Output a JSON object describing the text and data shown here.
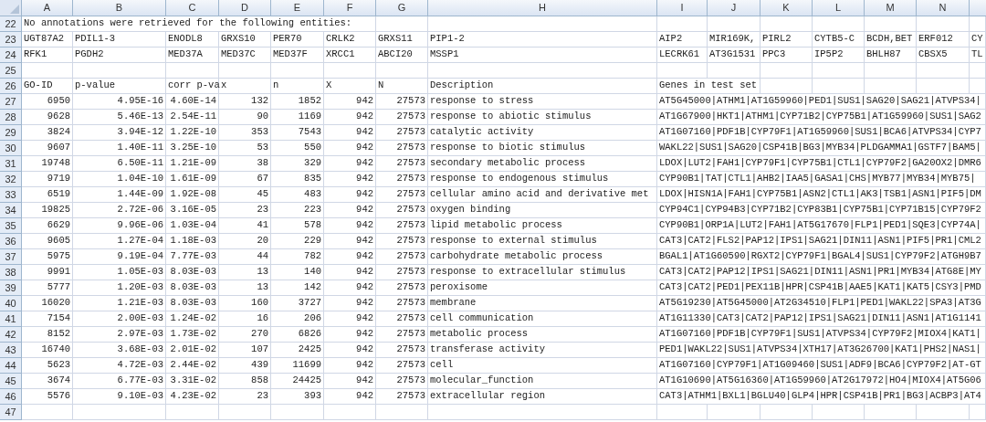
{
  "columns": [
    "A",
    "B",
    "C",
    "D",
    "E",
    "F",
    "G",
    "H",
    "I",
    "J",
    "K",
    "L",
    "M",
    "N"
  ],
  "rows": [
    {
      "number": "22",
      "kind": "note",
      "text": "No annotations were retrieved for the following entities:"
    },
    {
      "number": "23",
      "kind": "entities",
      "cells": [
        "UGT87A2",
        "PDIL1-3",
        "ENODL8",
        "GRXS10",
        "PER70",
        "CRLK2",
        "GRXS11",
        "PIP1-2",
        "AIP2",
        "MIR169K,",
        "PIRL2",
        "CYTB5-C",
        "BCDH,BET",
        "ERF012",
        "CY"
      ]
    },
    {
      "number": "24",
      "kind": "entities",
      "cells": [
        "RFK1",
        "PGDH2",
        "MED37A",
        "MED37C",
        "MED37F",
        "XRCC1",
        "ABCI20",
        "MSSP1",
        "LECRK61",
        "AT3G1531",
        "PPC3",
        "IP5P2",
        "BHLH87",
        "CBSX5",
        "TL"
      ]
    },
    {
      "number": "25",
      "kind": "blank"
    },
    {
      "number": "26",
      "kind": "header",
      "cells": [
        "GO-ID",
        "p-value",
        "corr p-va",
        "x",
        "n",
        "X",
        "N",
        "Description",
        "Genes in test set"
      ]
    },
    {
      "number": "27",
      "kind": "data",
      "cells": [
        "6950",
        "4.95E-16",
        "4.60E-14",
        "132",
        "1852",
        "942",
        "27573",
        "response to stress",
        "AT5G45000|ATHM1|AT1G59960|PED1|SUS1|SAG20|SAG21|ATVPS34|"
      ]
    },
    {
      "number": "28",
      "kind": "data",
      "cells": [
        "9628",
        "5.46E-13",
        "2.54E-11",
        "90",
        "1169",
        "942",
        "27573",
        "response to abiotic stimulus",
        "AT1G67900|HKT1|ATHM1|CYP71B2|CYP75B1|AT1G59960|SUS1|SAG2"
      ]
    },
    {
      "number": "29",
      "kind": "data",
      "cells": [
        "3824",
        "3.94E-12",
        "1.22E-10",
        "353",
        "7543",
        "942",
        "27573",
        "catalytic activity",
        "AT1G07160|PDF1B|CYP79F1|AT1G59960|SUS1|BCA6|ATVPS34|CYP7"
      ]
    },
    {
      "number": "30",
      "kind": "data",
      "cells": [
        "9607",
        "1.40E-11",
        "3.25E-10",
        "53",
        "550",
        "942",
        "27573",
        "response to biotic stimulus",
        "WAKL22|SUS1|SAG20|CSP41B|BG3|MYB34|PLDGAMMA1|GSTF7|BAM5|"
      ]
    },
    {
      "number": "31",
      "kind": "data",
      "cells": [
        "19748",
        "6.50E-11",
        "1.21E-09",
        "38",
        "329",
        "942",
        "27573",
        "secondary metabolic process",
        "LDOX|LUT2|FAH1|CYP79F1|CYP75B1|CTL1|CYP79F2|GA20OX2|DMR6"
      ]
    },
    {
      "number": "32",
      "kind": "data",
      "cells": [
        "9719",
        "1.04E-10",
        "1.61E-09",
        "67",
        "835",
        "942",
        "27573",
        "response to endogenous stimulus",
        "CYP90B1|TAT|CTL1|AHB2|IAA5|GASA1|CHS|MYB77|MYB34|MYB75|"
      ]
    },
    {
      "number": "33",
      "kind": "data",
      "cells": [
        "6519",
        "1.44E-09",
        "1.92E-08",
        "45",
        "483",
        "942",
        "27573",
        "cellular amino acid and derivative met",
        "LDOX|HISN1A|FAH1|CYP75B1|ASN2|CTL1|AK3|TSB1|ASN1|PIF5|DM"
      ]
    },
    {
      "number": "34",
      "kind": "data",
      "cells": [
        "19825",
        "2.72E-06",
        "3.16E-05",
        "23",
        "223",
        "942",
        "27573",
        "oxygen binding",
        "CYP94C1|CYP94B3|CYP71B2|CYP83B1|CYP75B1|CYP71B15|CYP79F2"
      ]
    },
    {
      "number": "35",
      "kind": "data",
      "cells": [
        "6629",
        "9.96E-06",
        "1.03E-04",
        "41",
        "578",
        "942",
        "27573",
        "lipid metabolic process",
        "CYP90B1|ORP1A|LUT2|FAH1|AT5G17670|FLP1|PED1|SQE3|CYP74A|"
      ]
    },
    {
      "number": "36",
      "kind": "data",
      "cells": [
        "9605",
        "1.27E-04",
        "1.18E-03",
        "20",
        "229",
        "942",
        "27573",
        "response to external stimulus",
        "CAT3|CAT2|FLS2|PAP12|IPS1|SAG21|DIN11|ASN1|PIF5|PR1|CML2"
      ]
    },
    {
      "number": "37",
      "kind": "data",
      "cells": [
        "5975",
        "9.19E-04",
        "7.77E-03",
        "44",
        "782",
        "942",
        "27573",
        "carbohydrate metabolic process",
        "BGAL1|AT1G60590|RGXT2|CYP79F1|BGAL4|SUS1|CYP79F2|ATGH9B7"
      ]
    },
    {
      "number": "38",
      "kind": "data",
      "cells": [
        "9991",
        "1.05E-03",
        "8.03E-03",
        "13",
        "140",
        "942",
        "27573",
        "response to extracellular stimulus",
        "CAT3|CAT2|PAP12|IPS1|SAG21|DIN11|ASN1|PR1|MYB34|ATG8E|MY"
      ]
    },
    {
      "number": "39",
      "kind": "data",
      "cells": [
        "5777",
        "1.20E-03",
        "8.03E-03",
        "13",
        "142",
        "942",
        "27573",
        "peroxisome",
        "CAT3|CAT2|PED1|PEX11B|HPR|CSP41B|AAE5|KAT1|KAT5|CSY3|PMD"
      ]
    },
    {
      "number": "40",
      "kind": "data",
      "cells": [
        "16020",
        "1.21E-03",
        "8.03E-03",
        "160",
        "3727",
        "942",
        "27573",
        "membrane",
        "AT5G19230|AT5G45000|AT2G34510|FLP1|PED1|WAKL22|SPA3|AT3G"
      ]
    },
    {
      "number": "41",
      "kind": "data",
      "cells": [
        "7154",
        "2.00E-03",
        "1.24E-02",
        "16",
        "206",
        "942",
        "27573",
        "cell communication",
        "AT1G11330|CAT3|CAT2|PAP12|IPS1|SAG21|DIN11|ASN1|AT1G1141"
      ]
    },
    {
      "number": "42",
      "kind": "data",
      "cells": [
        "8152",
        "2.97E-03",
        "1.73E-02",
        "270",
        "6826",
        "942",
        "27573",
        "metabolic process",
        "AT1G07160|PDF1B|CYP79F1|SUS1|ATVPS34|CYP79F2|MIOX4|KAT1|"
      ]
    },
    {
      "number": "43",
      "kind": "data",
      "cells": [
        "16740",
        "3.68E-03",
        "2.01E-02",
        "107",
        "2425",
        "942",
        "27573",
        "transferase activity",
        "PED1|WAKL22|SUS1|ATVPS34|XTH17|AT3G26700|KAT1|PHS2|NAS1|"
      ]
    },
    {
      "number": "44",
      "kind": "data",
      "cells": [
        "5623",
        "4.72E-03",
        "2.44E-02",
        "439",
        "11699",
        "942",
        "27573",
        "cell",
        "AT1G07160|CYP79F1|AT1G09460|SUS1|ADF9|BCA6|CYP79F2|AT-GT"
      ]
    },
    {
      "number": "45",
      "kind": "data",
      "cells": [
        "3674",
        "6.77E-03",
        "3.31E-02",
        "858",
        "24425",
        "942",
        "27573",
        "molecular_function",
        "AT1G10690|AT5G16360|AT1G59960|AT2G17972|HO4|MIOX4|AT5G06"
      ]
    },
    {
      "number": "46",
      "kind": "data",
      "cells": [
        "5576",
        "9.10E-03",
        "4.23E-02",
        "23",
        "393",
        "942",
        "27573",
        "extracellular region",
        "CAT3|ATHM1|BXL1|BGLU40|GLP4|HPR|CSP41B|PR1|BG3|ACBP3|AT4"
      ]
    },
    {
      "number": "47",
      "kind": "blank"
    }
  ]
}
